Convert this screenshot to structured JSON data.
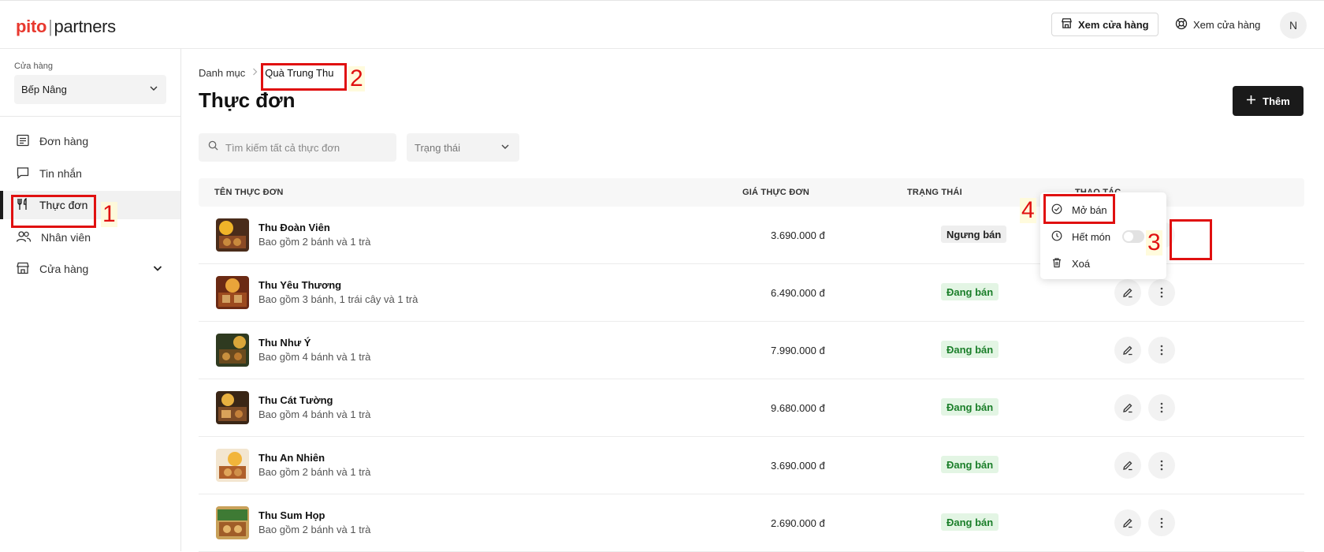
{
  "brand": {
    "logo_brand": "pito",
    "logo_sep": "|",
    "logo_product": "partners",
    "accent": "#e8392f"
  },
  "header": {
    "view_store_btn": "Xem cửa hàng",
    "view_store_link": "Xem cửa hàng",
    "avatar_initial": "N"
  },
  "sidebar": {
    "store_label": "Cửa hàng",
    "store_value": "Bếp Nâng",
    "items": [
      {
        "label": "Đơn hàng",
        "icon": "order-list-icon"
      },
      {
        "label": "Tin nhắn",
        "icon": "message-icon"
      },
      {
        "label": "Thực đơn",
        "icon": "fork-knife-icon",
        "active": true
      },
      {
        "label": "Nhân viên",
        "icon": "users-icon"
      },
      {
        "label": "Cửa hàng",
        "icon": "store-icon"
      }
    ]
  },
  "breadcrumb": {
    "root": "Danh mục",
    "separator": ">",
    "current": "Quà Trung Thu"
  },
  "page": {
    "title": "Thực đơn",
    "add_button": "Thêm"
  },
  "filters": {
    "search_placeholder": "Tìm kiếm tất cả thực đơn",
    "status_placeholder": "Trạng thái"
  },
  "table": {
    "columns": [
      "TÊN THỰC ĐƠN",
      "GIÁ THỰC ĐƠN",
      "TRẠNG THÁI",
      "THAO TÁC"
    ],
    "rows": [
      {
        "name": "Thu Đoàn Viên",
        "desc": "Bao gồm 2 bánh và 1 trà",
        "price": "3.690.000 đ",
        "status": "Ngưng bán",
        "active": false
      },
      {
        "name": "Thu Yêu Thương",
        "desc": "Bao gồm 3 bánh, 1 trái cây và 1 trà",
        "price": "6.490.000 đ",
        "status": "Đang bán",
        "active": true
      },
      {
        "name": "Thu Như Ý",
        "desc": "Bao gồm 4 bánh và 1 trà",
        "price": "7.990.000 đ",
        "status": "Đang bán",
        "active": true
      },
      {
        "name": "Thu Cát Tường",
        "desc": "Bao gồm 4 bánh và 1 trà",
        "price": "9.680.000 đ",
        "status": "Đang bán",
        "active": true
      },
      {
        "name": "Thu An Nhiên",
        "desc": "Bao gồm 2 bánh và 1 trà",
        "price": "3.690.000 đ",
        "status": "Đang bán",
        "active": true
      },
      {
        "name": "Thu Sum Họp",
        "desc": "Bao gồm 2 bánh và 1 trà",
        "price": "2.690.000 đ",
        "status": "Đang bán",
        "active": true
      }
    ]
  },
  "context_menu": {
    "open": "Mở bán",
    "sold_out": "Hết món",
    "delete": "Xoá",
    "sold_out_toggle": false
  },
  "annotations": [
    "1",
    "2",
    "3",
    "4"
  ],
  "colors": {
    "annotation": "#e01010",
    "badge_active_bg": "#e3f5e4",
    "badge_active_text": "#1b7f2a",
    "primary_button": "#1a1a1a"
  }
}
